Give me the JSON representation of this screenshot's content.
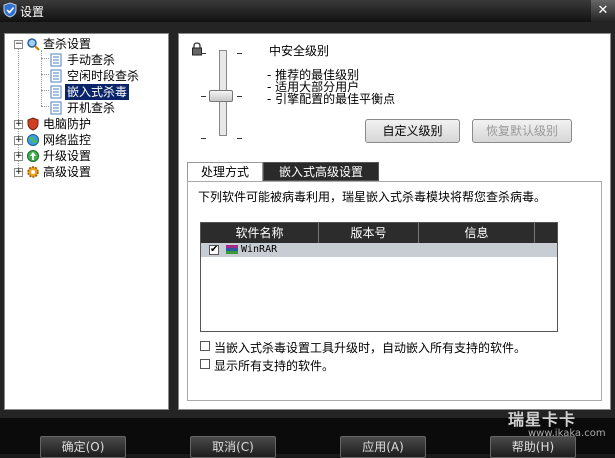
{
  "window": {
    "title": "设置",
    "close_glyph": "✕"
  },
  "tree": {
    "items": [
      {
        "label": "查杀设置",
        "icon": "magnifier-search-icon"
      },
      {
        "label": "手动查杀",
        "icon": "document-icon"
      },
      {
        "label": "空闲时段查杀",
        "icon": "document-icon"
      },
      {
        "label": "嵌入式杀毒",
        "icon": "document-icon",
        "selected": true
      },
      {
        "label": "开机查杀",
        "icon": "document-icon"
      },
      {
        "label": "电脑防护",
        "icon": "shield-icon"
      },
      {
        "label": "网络监控",
        "icon": "globe-icon"
      },
      {
        "label": "升级设置",
        "icon": "upgrade-icon"
      },
      {
        "label": "高级设置",
        "icon": "gear-icon"
      }
    ],
    "expanded_glyph": "−",
    "collapsed_glyph": "+"
  },
  "level": {
    "title": "中安全级别",
    "desc": [
      "- 推荐的最佳级别",
      "- 适用大部分用户",
      "- 引擎配置的最佳平衡点"
    ],
    "tick_glyph": "-",
    "slider_level": 0.5
  },
  "buttons": {
    "custom_level": "自定义级别",
    "restore_default": "恢复默认级别"
  },
  "tabs": [
    {
      "label": "处理方式",
      "active": false
    },
    {
      "label": "嵌入式高级设置",
      "active": true
    }
  ],
  "embedded": {
    "intro": "下列软件可能被病毒利用，瑞星嵌入式杀毒模块将帮您查杀病毒。",
    "columns": [
      "软件名称",
      "版本号",
      "信息"
    ],
    "rows": [
      {
        "name": "WinRAR",
        "checked": true,
        "icon": "winrar-icon"
      }
    ],
    "check_glyph": "✔",
    "option_auto_embed": "当嵌入式杀毒设置工具升级时，自动嵌入所有支持的软件。",
    "option_show_all": "显示所有支持的软件。"
  },
  "footer": {
    "ok": "确定(O)",
    "cancel": "取消(C)",
    "apply": "应用(A)",
    "help": "帮助(H)"
  },
  "watermark": {
    "brand": "瑞星卡卡",
    "url": "www.ikaka.com"
  }
}
